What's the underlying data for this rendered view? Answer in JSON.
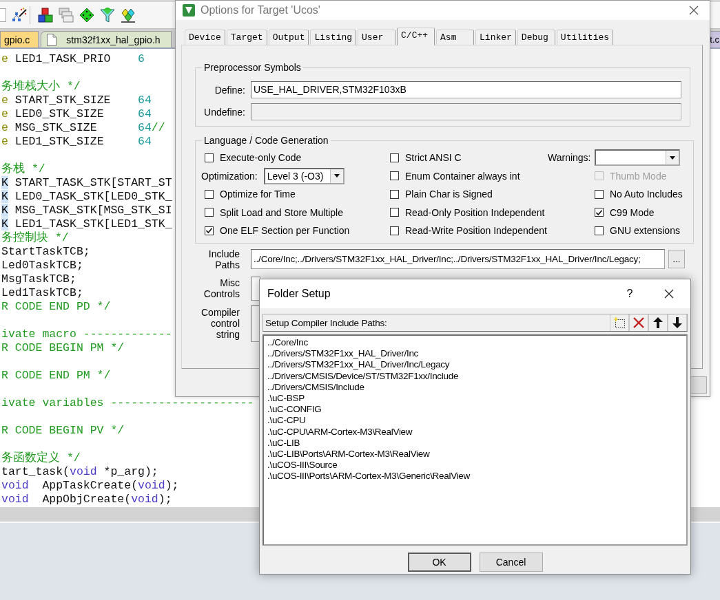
{
  "ide": {
    "tabs": [
      {
        "label": "gpio.c",
        "color": "#fbd87f",
        "icon": false
      },
      {
        "label": "stm32f1xx_hal_gpio.h",
        "color": "#dbe6cd",
        "icon": true
      },
      {
        "label": "t.c",
        "color": "#cbc4e0",
        "icon": false
      }
    ],
    "code_lines": [
      {
        "kind": "code",
        "segments": [
          {
            "kind": "keyword",
            "text": "e"
          },
          {
            "kind": "plain",
            "text": " LED1_TASK_PRIO"
          },
          {
            "kind": "number",
            "text": "6"
          }
        ]
      },
      {
        "kind": "blank"
      },
      {
        "kind": "code",
        "segments": [
          {
            "kind": "comment",
            "text": "务堆栈大小 */"
          }
        ]
      },
      {
        "kind": "code",
        "segments": [
          {
            "kind": "keyword",
            "text": "e"
          },
          {
            "kind": "plain",
            "text": " START_STK_SIZE"
          },
          {
            "kind": "number",
            "text": "64"
          }
        ]
      },
      {
        "kind": "code",
        "segments": [
          {
            "kind": "keyword",
            "text": "e"
          },
          {
            "kind": "plain",
            "text": " LED0_STK_SIZE"
          },
          {
            "kind": "number",
            "text": "64"
          }
        ]
      },
      {
        "kind": "code",
        "segments": [
          {
            "kind": "keyword",
            "text": "e"
          },
          {
            "kind": "plain",
            "text": " MSG_STK_SIZE"
          },
          {
            "kind": "number",
            "text": "64"
          },
          {
            "kind": "comment",
            "text": "//"
          }
        ]
      },
      {
        "kind": "code",
        "segments": [
          {
            "kind": "keyword",
            "text": "e"
          },
          {
            "kind": "plain",
            "text": " LED1_STK_SIZE"
          },
          {
            "kind": "number",
            "text": "64"
          }
        ]
      },
      {
        "kind": "blank"
      },
      {
        "kind": "code",
        "segments": [
          {
            "kind": "comment",
            "text": "务栈 */"
          }
        ]
      },
      {
        "kind": "code",
        "segments": [
          {
            "kind": "marked",
            "text": "K"
          },
          {
            "kind": "plain",
            "text": " START_TASK_STK[START_ST"
          }
        ]
      },
      {
        "kind": "code",
        "segments": [
          {
            "kind": "marked",
            "text": "K"
          },
          {
            "kind": "plain",
            "text": " LED0_TASK_STK[LED0_STK_"
          }
        ]
      },
      {
        "kind": "code",
        "segments": [
          {
            "kind": "marked",
            "text": "K"
          },
          {
            "kind": "plain",
            "text": " MSG_TASK_STK[MSG_STK_SI"
          }
        ]
      },
      {
        "kind": "code",
        "segments": [
          {
            "kind": "marked",
            "text": "K"
          },
          {
            "kind": "plain",
            "text": " LED1_TASK_STK[LED1_STK_"
          }
        ]
      },
      {
        "kind": "code",
        "segments": [
          {
            "kind": "comment",
            "text": "务控制块 */"
          }
        ]
      },
      {
        "kind": "code",
        "segments": [
          {
            "kind": "plain",
            "text": "StartTaskTCB;"
          }
        ]
      },
      {
        "kind": "code",
        "segments": [
          {
            "kind": "plain",
            "text": "Led0TaskTCB;"
          }
        ]
      },
      {
        "kind": "code",
        "segments": [
          {
            "kind": "plain",
            "text": "MsgTaskTCB;"
          }
        ]
      },
      {
        "kind": "code",
        "segments": [
          {
            "kind": "plain",
            "text": "Led1TaskTCB;"
          }
        ]
      },
      {
        "kind": "code",
        "segments": [
          {
            "kind": "comment",
            "text": "R CODE END PD */"
          }
        ]
      },
      {
        "kind": "blank"
      },
      {
        "kind": "code",
        "segments": [
          {
            "kind": "comment",
            "text": "ivate macro -------------"
          }
        ]
      },
      {
        "kind": "code",
        "segments": [
          {
            "kind": "comment",
            "text": "R CODE BEGIN PM */"
          }
        ]
      },
      {
        "kind": "blank"
      },
      {
        "kind": "code",
        "segments": [
          {
            "kind": "comment",
            "text": "R CODE END PM */"
          }
        ]
      },
      {
        "kind": "blank"
      },
      {
        "kind": "code",
        "segments": [
          {
            "kind": "comment",
            "text": "ivate variables ---------------------"
          }
        ]
      },
      {
        "kind": "blank"
      },
      {
        "kind": "code",
        "segments": [
          {
            "kind": "comment",
            "text": "R CODE BEGIN PV */"
          }
        ]
      },
      {
        "kind": "blank"
      },
      {
        "kind": "code",
        "segments": [
          {
            "kind": "comment",
            "text": "务函数定义 */"
          }
        ]
      },
      {
        "kind": "code",
        "segments": [
          {
            "kind": "plain",
            "text": "tart_task("
          },
          {
            "kind": "type",
            "text": "void"
          },
          {
            "kind": "plain",
            "text": " *p_arg);"
          }
        ]
      },
      {
        "kind": "code",
        "segments": [
          {
            "kind": "type",
            "text": "void"
          },
          {
            "kind": "plain",
            "text": "  AppTaskCreate("
          },
          {
            "kind": "type",
            "text": "void"
          },
          {
            "kind": "plain",
            "text": ");"
          }
        ]
      },
      {
        "kind": "code",
        "segments": [
          {
            "kind": "type",
            "text": "void"
          },
          {
            "kind": "plain",
            "text": "  AppObjCreate("
          },
          {
            "kind": "type",
            "text": "void"
          },
          {
            "kind": "plain",
            "text": ");"
          }
        ]
      }
    ]
  },
  "options_dialog": {
    "title": "Options for Target 'Ucos'",
    "tabs": [
      {
        "label": "Device",
        "selected": false
      },
      {
        "label": "Target",
        "selected": false
      },
      {
        "label": "Output",
        "selected": false
      },
      {
        "label": "Listing",
        "selected": false
      },
      {
        "label": "User",
        "selected": false
      },
      {
        "label": "C/C++",
        "selected": true
      },
      {
        "label": "Asm",
        "selected": false
      },
      {
        "label": "Linker",
        "selected": false
      },
      {
        "label": "Debug",
        "selected": false
      },
      {
        "label": "Utilities",
        "selected": false
      }
    ],
    "preprocessor": {
      "title": "Preprocessor Symbols",
      "fields": [
        {
          "label": "Define:",
          "value": "USE_HAL_DRIVER,STM32F103xB",
          "disabled": false
        },
        {
          "label": "Undefine:",
          "disabled": true
        }
      ]
    },
    "language": {
      "title": "Language / Code Generation",
      "columns": [
        {
          "items": [
            {
              "kind": "checkbox",
              "label": "Execute-only Code",
              "checked": false,
              "disabled": false
            },
            {
              "kind": "select",
              "label": "Optimization:",
              "value": "Level 3 (-O3)"
            },
            {
              "kind": "checkbox",
              "label": "Optimize for Time",
              "checked": false,
              "disabled": false
            },
            {
              "kind": "checkbox",
              "label": "Split Load and Store Multiple",
              "checked": false,
              "disabled": false
            },
            {
              "kind": "checkbox",
              "label": "One ELF Section per Function",
              "checked": true,
              "disabled": false
            }
          ]
        },
        {
          "items": [
            {
              "kind": "checkbox",
              "label": "Strict ANSI C",
              "checked": false,
              "disabled": false
            },
            {
              "kind": "checkbox",
              "label": "Enum Container always int",
              "checked": false,
              "disabled": false
            },
            {
              "kind": "checkbox",
              "label": "Plain Char is Signed",
              "checked": false,
              "disabled": false
            },
            {
              "kind": "checkbox",
              "label": "Read-Only Position Independent",
              "checked": false,
              "disabled": false
            },
            {
              "kind": "checkbox",
              "label": "Read-Write Position Independent",
              "checked": false,
              "disabled": false
            }
          ]
        },
        {
          "items": [
            {
              "kind": "select",
              "label": "Warnings:"
            },
            {
              "kind": "checkbox",
              "label": "Thumb Mode",
              "checked": false,
              "disabled": true
            },
            {
              "kind": "checkbox",
              "label": "No Auto Includes",
              "checked": false,
              "disabled": false
            },
            {
              "kind": "checkbox",
              "label": "C99 Mode",
              "checked": true,
              "disabled": false
            },
            {
              "kind": "checkbox",
              "label": "GNU extensions",
              "checked": false,
              "disabled": false
            }
          ]
        }
      ]
    },
    "paths": [
      {
        "kind": "input",
        "label": "Include Paths",
        "value": "../Core/Inc;../Drivers/STM32F1xx_HAL_Driver/Inc;../Drivers/STM32F1xx_HAL_Driver/Inc/Legacy;",
        "button": "..."
      },
      {
        "kind": "input",
        "label": "Misc Controls"
      },
      {
        "kind": "textarea",
        "label": "Compiler control string"
      }
    ]
  },
  "folder_dialog": {
    "title": "Folder Setup",
    "help": "?",
    "heading": "Setup Compiler Include Paths:",
    "paths": [
      "../Core/Inc",
      "../Drivers/STM32F1xx_HAL_Driver/Inc",
      "../Drivers/STM32F1xx_HAL_Driver/Inc/Legacy",
      "../Drivers/CMSIS/Device/ST/STM32F1xx/Include",
      "../Drivers/CMSIS/Include",
      ".\\uC-BSP",
      ".\\uC-CONFIG",
      ".\\uC-CPU",
      ".\\uC-CPU\\ARM-Cortex-M3\\RealView",
      ".\\uC-LIB",
      ".\\uC-LIB\\Ports\\ARM-Cortex-M3\\RealView",
      ".\\uCOS-III\\Source",
      ".\\uCOS-III\\Ports\\ARM-Cortex-M3\\Generic\\RealView"
    ],
    "buttons": [
      {
        "label": "OK",
        "default": true
      },
      {
        "label": "Cancel",
        "default": false
      }
    ]
  }
}
